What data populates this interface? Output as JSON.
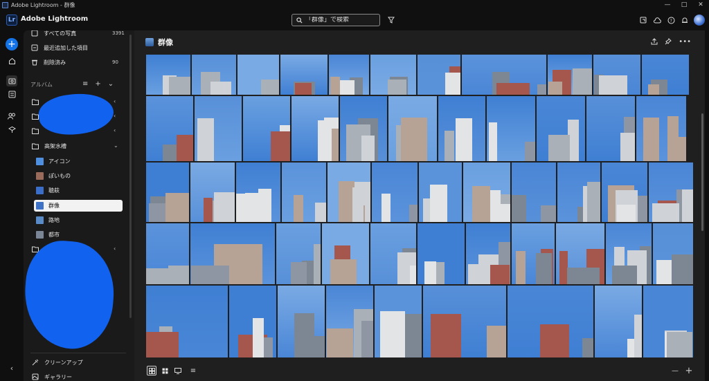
{
  "window": {
    "title": "Adobe Lightroom - 群像"
  },
  "app": {
    "name": "Adobe Lightroom",
    "logo": "Lr"
  },
  "search": {
    "placeholder": "「群像」で検索"
  },
  "library": [
    {
      "label": "すべての写真",
      "count": "3391",
      "icon": "photos-icon"
    },
    {
      "label": "最近追加した項目",
      "count": "",
      "icon": "recent-icon"
    },
    {
      "label": "削除済み",
      "count": "90",
      "icon": "trash-icon"
    }
  ],
  "albums": {
    "header": "アルバム",
    "folder": "高架水槽",
    "items": [
      {
        "label": "アイコン",
        "color": "#4f8fe0"
      },
      {
        "label": "ぽいもの",
        "color": "#9a6a5a"
      },
      {
        "label": "聴萩",
        "color": "#3a6ec8"
      },
      {
        "label": "群像",
        "color": "#3d72c6"
      },
      {
        "label": "路地",
        "color": "#5a8bc9"
      },
      {
        "label": "都市",
        "color": "#7a8595"
      }
    ]
  },
  "bottom_nav": [
    {
      "label": "クリーンアップ"
    },
    {
      "label": "ギャラリー"
    }
  ],
  "main": {
    "title": "群像"
  },
  "colors": {
    "accent": "#1473e6",
    "scribble": "#1262f0",
    "sky": "#4a86d6"
  }
}
